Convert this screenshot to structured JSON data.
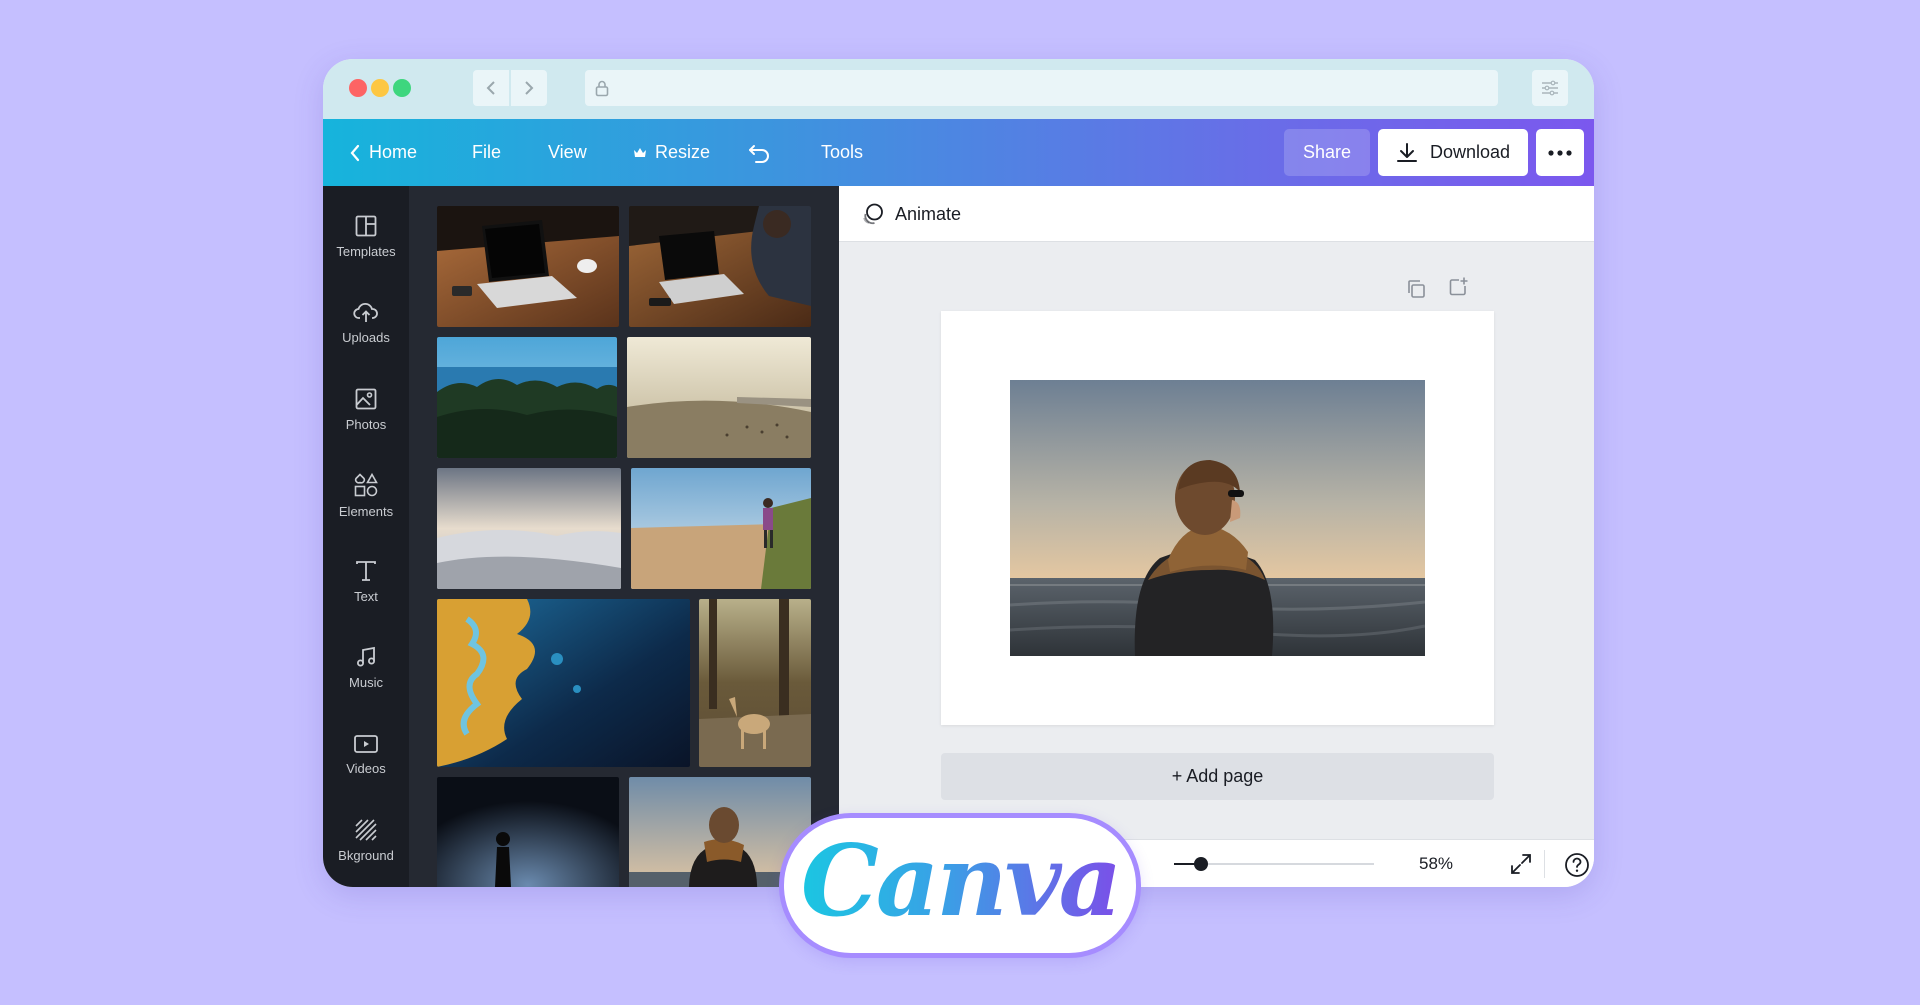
{
  "toolbar": {
    "home": "Home",
    "file": "File",
    "view": "View",
    "resize": "Resize",
    "tools": "Tools",
    "share": "Share",
    "download": "Download"
  },
  "sidenav": {
    "items": [
      {
        "label": "Templates",
        "icon": "templates-icon"
      },
      {
        "label": "Uploads",
        "icon": "upload-cloud-icon"
      },
      {
        "label": "Photos",
        "icon": "photo-icon"
      },
      {
        "label": "Elements",
        "icon": "shapes-icon"
      },
      {
        "label": "Text",
        "icon": "text-icon"
      },
      {
        "label": "Music",
        "icon": "music-note-icon"
      },
      {
        "label": "Videos",
        "icon": "video-play-icon"
      },
      {
        "label": "Bkground",
        "icon": "background-hatch-icon"
      }
    ]
  },
  "editor": {
    "animate": "Animate",
    "add_page": "+ Add page",
    "zoom": "58%",
    "zoom_fraction": 0.58
  },
  "logo": {
    "text": "Canva"
  },
  "colors": {
    "background": "#c5bfff",
    "toolbar_start": "#16b4dc",
    "toolbar_end": "#7b58ee",
    "sidebar": "#1a1d24",
    "panel": "#252932",
    "logo_border": "#a68cff"
  }
}
